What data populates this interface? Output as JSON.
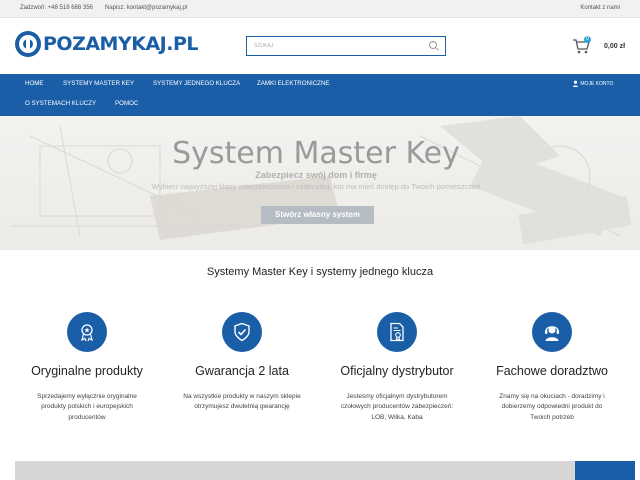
{
  "topbar": {
    "call": "Zadzwoń: +48 518 688 356",
    "mail": "Napisz: kontakt@pozamykaj.pl",
    "contact": "Kontakt z nami"
  },
  "header": {
    "logo_text": "POZAMYKAJ.PL",
    "search_placeholder": "SZUKAJ",
    "cart_count": "0",
    "cart_total": "0,00 zł"
  },
  "nav": {
    "items": [
      {
        "label": "HOME"
      },
      {
        "label": "SYSTEMY MASTER KEY"
      },
      {
        "label": "SYSTEMY JEDNEGO KLUCZA"
      },
      {
        "label": "ZAMKI ELEKTRONICZNE"
      },
      {
        "label": "O SYSTEMACH KLUCZY"
      },
      {
        "label": "POMOC"
      }
    ],
    "account": "MOJE KONTO"
  },
  "hero": {
    "title": "System Master Key",
    "subtitle": "Zabezpiecz swój dom i firmę",
    "description": "Wybierz najwyższej klasy zabezpieczenia i zadecyduj, kto ma mieć dostęp do Twoich pomieszczeń",
    "button": "Stwórz własny system"
  },
  "features_title": "Systemy Master Key i systemy jednego klucza",
  "features": [
    {
      "icon": "award-medal-icon",
      "title": "Oryginalne produkty",
      "desc": "Sprzedajemy wyłącznie oryginalne produkty polskich i europejskich producentów"
    },
    {
      "icon": "shield-check-icon",
      "title": "Gwarancja 2 lata",
      "desc": "Na wszystkie produkty w naszym sklepie otrzymujesz dwuletnią gwarancję"
    },
    {
      "icon": "certificate-document-icon",
      "title": "Oficjalny dystrybutor",
      "desc": "Jesteśmy oficjalnym dystrybutorem czołowych producentów zabezpieczeń: LOB, Wilka, Kaba"
    },
    {
      "icon": "headset-support-icon",
      "title": "Fachowe doradztwo",
      "desc": "Znamy się na okuciach - doradzimy i dobierzemy odpowiedni produkt do Twoich potrzeb"
    }
  ],
  "colors": {
    "brand_blue": "#1a5ea8",
    "accent_light_blue": "#2ea3d6",
    "hero_button": "#b5bcc4"
  }
}
